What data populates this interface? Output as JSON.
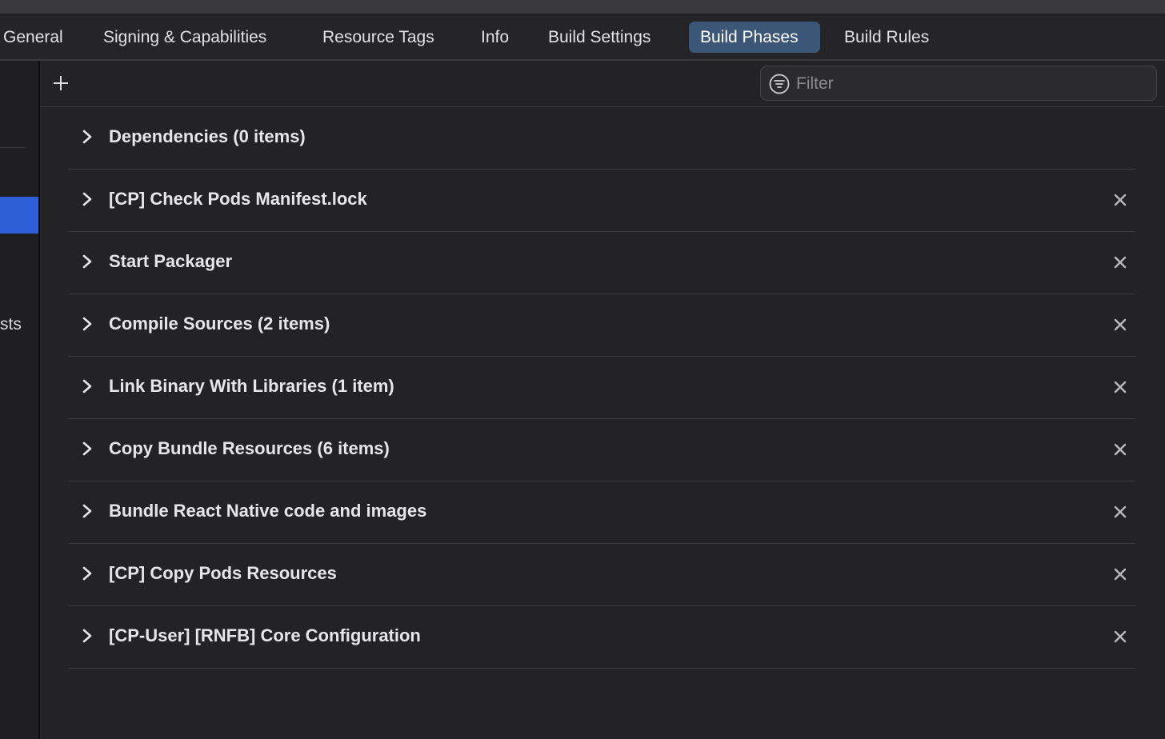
{
  "tabs": [
    {
      "label": "General",
      "selected": false
    },
    {
      "label": "Signing & Capabilities",
      "selected": false
    },
    {
      "label": "Resource Tags",
      "selected": false
    },
    {
      "label": "Info",
      "selected": false
    },
    {
      "label": "Build Settings",
      "selected": false
    },
    {
      "label": "Build Phases",
      "selected": true
    },
    {
      "label": "Build Rules",
      "selected": false
    }
  ],
  "sidebar": {
    "cut_text": "sts"
  },
  "toolbar": {
    "add_icon": "plus-icon",
    "filter": {
      "placeholder": "Filter",
      "value": "",
      "icon": "filter-icon"
    }
  },
  "phases": [
    {
      "label": "Dependencies (0 items)",
      "removable": false
    },
    {
      "label": "[CP] Check Pods Manifest.lock",
      "removable": true
    },
    {
      "label": "Start Packager",
      "removable": true
    },
    {
      "label": "Compile Sources (2 items)",
      "removable": true
    },
    {
      "label": "Link Binary With Libraries (1 item)",
      "removable": true
    },
    {
      "label": "Copy Bundle Resources (6 items)",
      "removable": true
    },
    {
      "label": "Bundle React Native code and images",
      "removable": true
    },
    {
      "label": "[CP] Copy Pods Resources",
      "removable": true
    },
    {
      "label": "[CP-User] [RNFB] Core Configuration",
      "removable": true
    }
  ],
  "colors": {
    "background": "#232225",
    "selected_tab": "#3b5677",
    "sidebar_selection": "#2f5fd8"
  }
}
